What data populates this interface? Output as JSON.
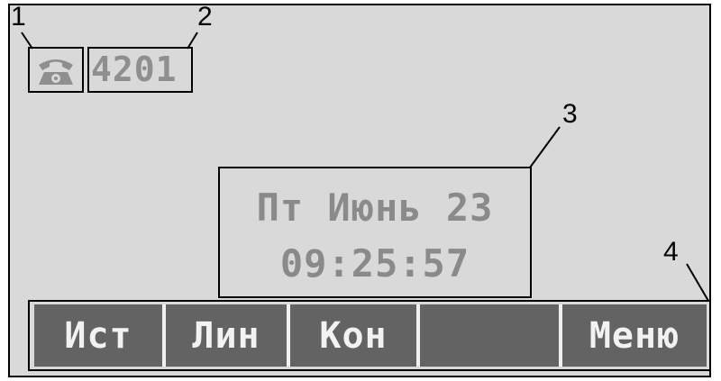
{
  "callouts": [
    "1",
    "2",
    "3",
    "4"
  ],
  "status": {
    "line_icon": "telephone-icon",
    "extension": "4201"
  },
  "clock": {
    "date": "Пт Июнь 23",
    "time": "09:25:57"
  },
  "softkeys": [
    "Ист",
    "Лин",
    "Кон",
    "",
    "Меню"
  ],
  "colors": {
    "screen_bg": "#d9d9d9",
    "lcd_text": "#8a8a8a",
    "softkey_bg": "#636363",
    "softkey_text": "#f2f2f2"
  }
}
